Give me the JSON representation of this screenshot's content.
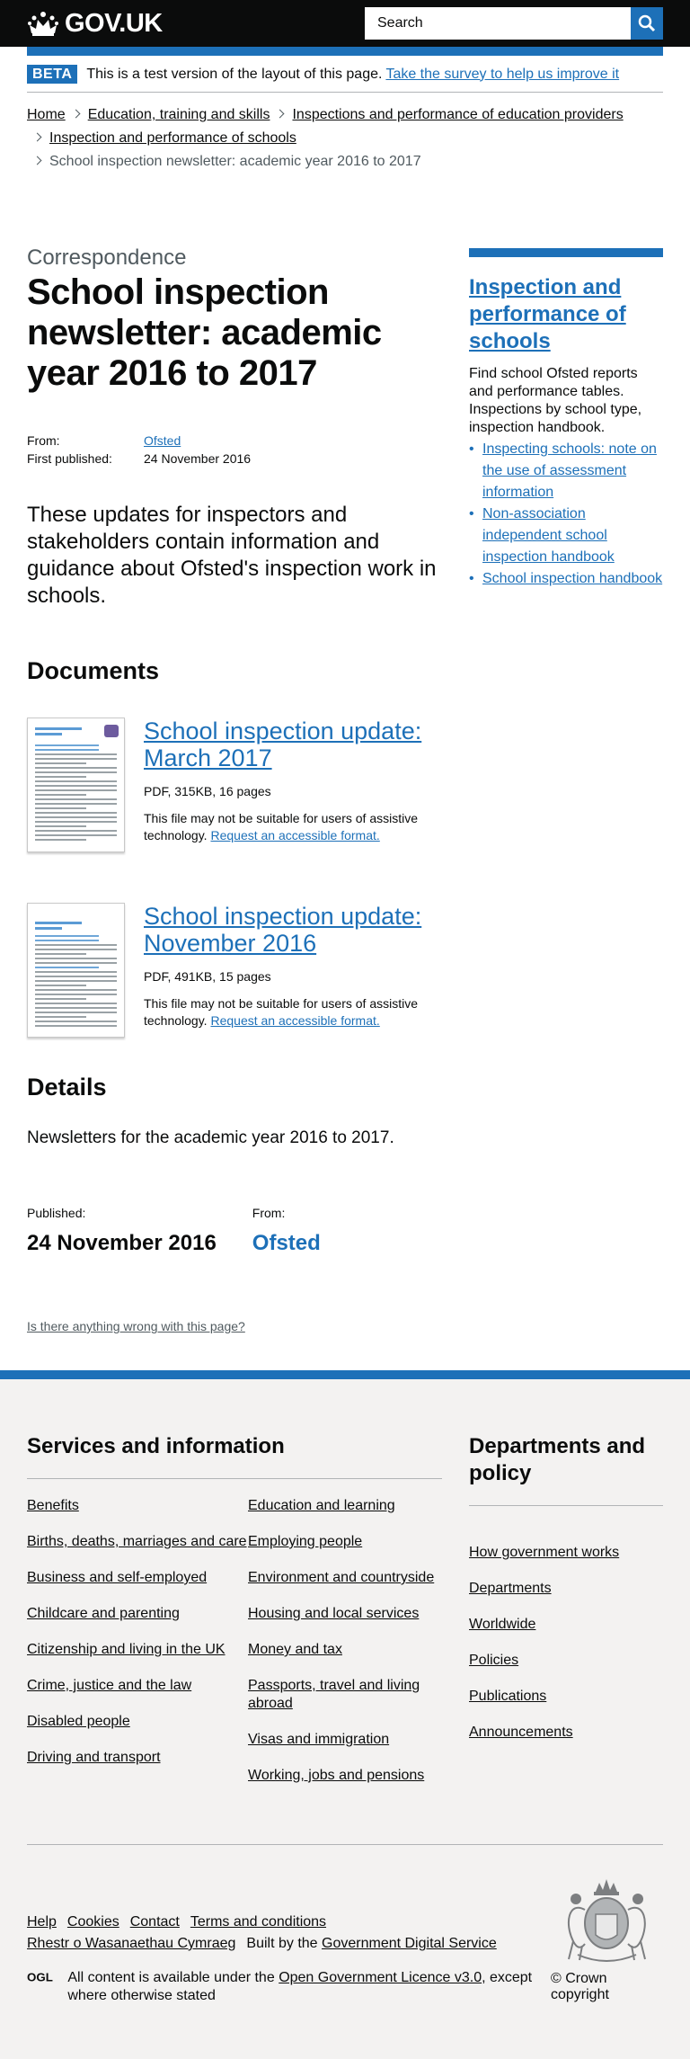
{
  "header": {
    "logo_text": "GOV.UK",
    "search_placeholder": "Search",
    "search_icon": "magnifier",
    "brand_color": "#1d70b8"
  },
  "phase_banner": {
    "tag": "BETA",
    "text": "This is a test version of the layout of this page.",
    "link": "Take the survey to help us improve it"
  },
  "breadcrumbs": [
    "Home",
    "Education, training and skills",
    "Inspections and performance of education providers",
    "Inspection and performance of schools",
    "School inspection newsletter: academic year 2016 to 2017"
  ],
  "page": {
    "caption": "Correspondence",
    "title": "School inspection newsletter: academic year 2016 to 2017",
    "meta": {
      "from_label": "From:",
      "from_value": "Ofsted",
      "published_label": "First published:",
      "published_value": "24 November 2016"
    },
    "lead": "These updates for inspectors and stakeholders contain information and guidance about Ofsted's inspection work in schools."
  },
  "documents": {
    "heading": "Documents",
    "items": [
      {
        "title": "School inspection update: March 2017",
        "meta": "PDF, 315KB, 16 pages",
        "note": "This file may not be suitable for users of assistive technology.",
        "link": "Request an accessible format."
      },
      {
        "title": "School inspection update: November 2016",
        "meta": "PDF, 491KB, 15 pages",
        "note": "This file may not be suitable for users of assistive technology.",
        "link": "Request an accessible format."
      }
    ]
  },
  "details": {
    "heading": "Details",
    "text": "Newsletters for the academic year 2016 to 2017.",
    "published_label": "Published:",
    "published_value": "24 November 2016",
    "from_label": "From:",
    "from_value": "Ofsted"
  },
  "feedback_link": "Is there anything wrong with this page?",
  "related": {
    "title": "Inspection and performance of schools",
    "description": "Find school Ofsted reports and performance tables. Inspections by school type, inspection handbook.",
    "links": [
      "Inspecting schools: note on the use of assessment information",
      "Non-association independent school inspection handbook",
      "School inspection handbook"
    ]
  },
  "footer": {
    "services_heading": "Services and information",
    "services_col1": [
      "Benefits",
      "Births, deaths, marriages and care",
      "Business and self-employed",
      "Childcare and parenting",
      "Citizenship and living in the UK",
      "Crime, justice and the law",
      "Disabled people",
      "Driving and transport"
    ],
    "services_col2": [
      "Education and learning",
      "Employing people",
      "Environment and countryside",
      "Housing and local services",
      "Money and tax",
      "Passports, travel and living abroad",
      "Visas and immigration",
      "Working, jobs and pensions"
    ],
    "departments_heading": "Departments and policy",
    "departments": [
      "How government works",
      "Departments",
      "Worldwide",
      "Policies",
      "Publications",
      "Announcements"
    ],
    "meta_links": [
      "Help",
      "Cookies",
      "Contact",
      "Terms and conditions"
    ],
    "welsh_link": "Rhestr o Wasanaethau Cymraeg",
    "built_by_prefix": "Built by the",
    "built_by_link": "Government Digital Service",
    "licence_prefix": "All content is available under the",
    "licence_link": "Open Government Licence v3.0",
    "licence_suffix": ", except where otherwise stated",
    "copyright": "© Crown copyright"
  }
}
